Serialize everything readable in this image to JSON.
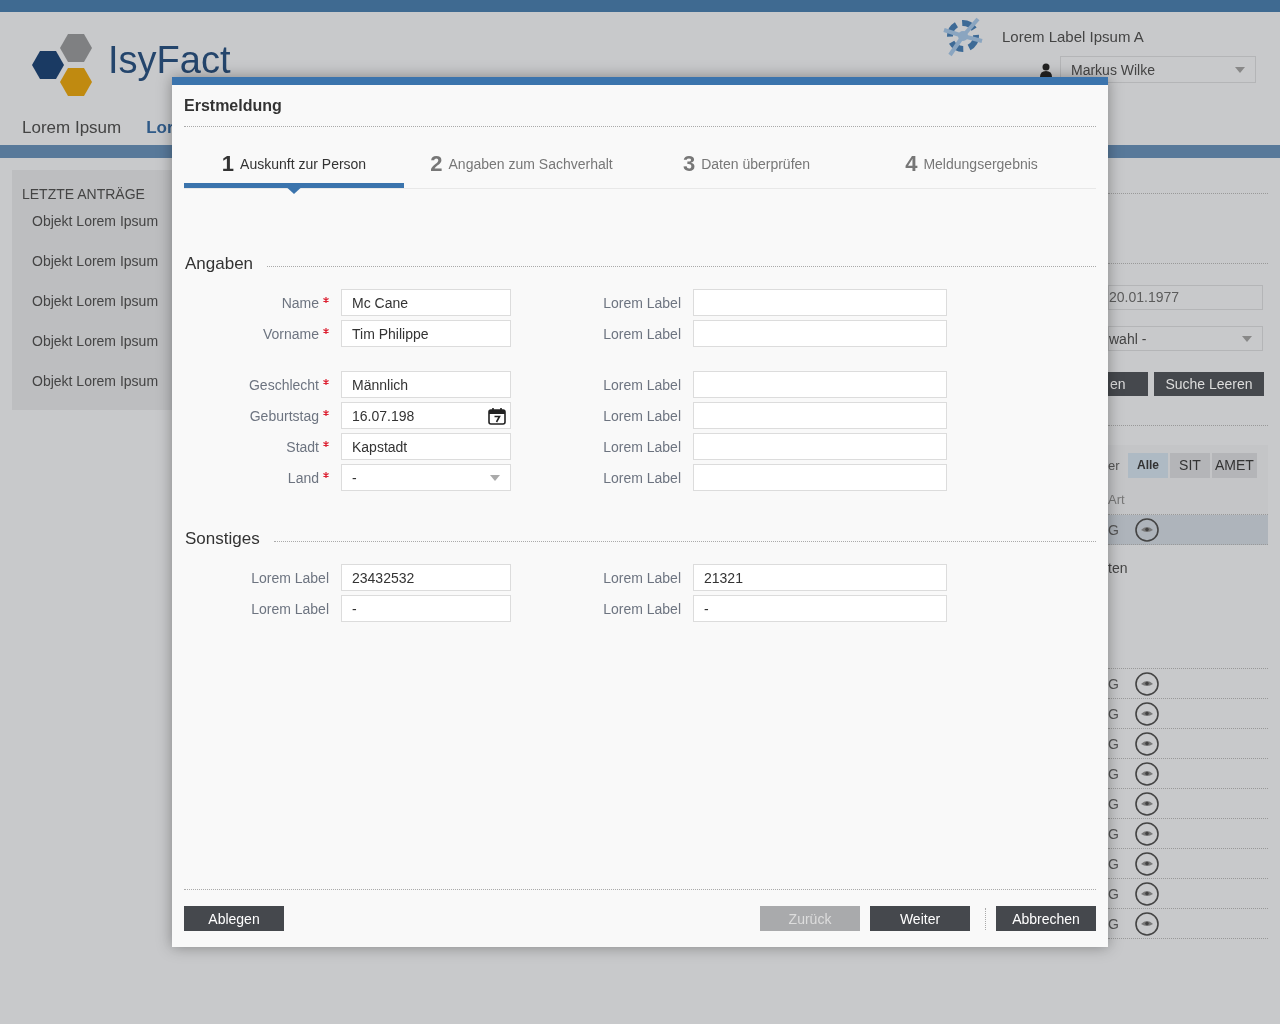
{
  "header": {
    "logo_text": "IsyFact",
    "nav": [
      {
        "label": "Lorem Ipsum",
        "selected": false
      },
      {
        "label": "Lor",
        "selected": true
      }
    ],
    "app_label": "Lorem Label Ipsum A",
    "user_select": {
      "value": "Markus Wilke"
    }
  },
  "sidebar": {
    "title": "LETZTE ANTRÄGE",
    "items": [
      "Objekt Lorem Ipsum",
      "Objekt Lorem Ipsum",
      "Objekt Lorem Ipsum",
      "Objekt Lorem Ipsum",
      "Objekt Lorem Ipsum"
    ]
  },
  "right_panel": {
    "date_field": {
      "value": "20.01.1977"
    },
    "select": {
      "value": "wahl -"
    },
    "buttons": [
      "en",
      "Suche Leeren"
    ],
    "filter_label": "er",
    "filter_tabs": [
      {
        "label": "Alle",
        "selected": true
      },
      {
        "label": "SIT",
        "selected": false
      },
      {
        "label": "AMET",
        "selected": false
      }
    ],
    "column_header": "Art",
    "top_rows": [
      {
        "cell": "G",
        "selected": true
      }
    ],
    "note": "ten",
    "rows": [
      {
        "cell": "G",
        "selected": false
      },
      {
        "cell": "G",
        "selected": false
      },
      {
        "cell": "G",
        "selected": false
      },
      {
        "cell": "G",
        "selected": false
      },
      {
        "cell": "G",
        "selected": false
      },
      {
        "cell": "G",
        "selected": false
      },
      {
        "cell": "G",
        "selected": false
      },
      {
        "cell": "G",
        "selected": false
      },
      {
        "cell": "G",
        "selected": false
      }
    ]
  },
  "dialog": {
    "title": "Erstmeldung",
    "steps": [
      {
        "number": "1",
        "label": "Auskunft zur Person",
        "selected": true
      },
      {
        "number": "2",
        "label": "Angaben zum Sachverhalt",
        "selected": false
      },
      {
        "number": "3",
        "label": "Daten überprüfen",
        "selected": false
      },
      {
        "number": "4",
        "label": "Meldungsergebnis",
        "selected": false
      }
    ],
    "sections": [
      {
        "title": "Angaben",
        "groups": [
          [
            {
              "left": {
                "label": "Name",
                "required": true,
                "kind": "text",
                "value": "Mc Cane"
              },
              "right": {
                "label": "Lorem Label",
                "required": false,
                "kind": "text"
              }
            },
            {
              "left": {
                "label": "Vorname",
                "required": true,
                "kind": "text",
                "value": "Tim Philippe"
              },
              "right": {
                "label": "Lorem Label",
                "required": false,
                "kind": "text"
              }
            }
          ],
          [
            {
              "left": {
                "label": "Geschlecht",
                "required": true,
                "kind": "text",
                "value": "Männlich"
              },
              "right": {
                "label": "Lorem Label",
                "required": false,
                "kind": "text"
              }
            },
            {
              "left": {
                "label": "Geburtstag",
                "required": true,
                "kind": "date",
                "value": "16.07.198"
              },
              "right": {
                "label": "Lorem Label",
                "required": false,
                "kind": "text"
              }
            },
            {
              "left": {
                "label": "Stadt",
                "required": true,
                "kind": "text",
                "value": "Kapstadt"
              },
              "right": {
                "label": "Lorem Label",
                "required": false,
                "kind": "text"
              }
            },
            {
              "left": {
                "label": "Land",
                "required": true,
                "kind": "select",
                "value": "-"
              },
              "right": {
                "label": "Lorem Label",
                "required": false,
                "kind": "text"
              }
            }
          ]
        ]
      },
      {
        "title": "Sonstiges",
        "groups": [
          [
            {
              "left": {
                "label": "Lorem Label",
                "required": false,
                "kind": "text",
                "value": "23432532"
              },
              "right": {
                "label": "Lorem Label",
                "required": false,
                "kind": "text",
                "value": "21321"
              }
            },
            {
              "left": {
                "label": "Lorem Label",
                "required": false,
                "kind": "text",
                "value": "-"
              },
              "right": {
                "label": "Lorem Label",
                "required": false,
                "kind": "text",
                "value": "-"
              }
            }
          ]
        ]
      }
    ],
    "footer": {
      "left_buttons": [
        {
          "label": "Ablegen",
          "disabled": false
        }
      ],
      "nav_buttons": [
        {
          "label": "Zurück",
          "disabled": true
        },
        {
          "label": "Weiter",
          "disabled": false
        }
      ],
      "cancel_button": {
        "label": "Abbrechen",
        "disabled": false
      }
    }
  }
}
